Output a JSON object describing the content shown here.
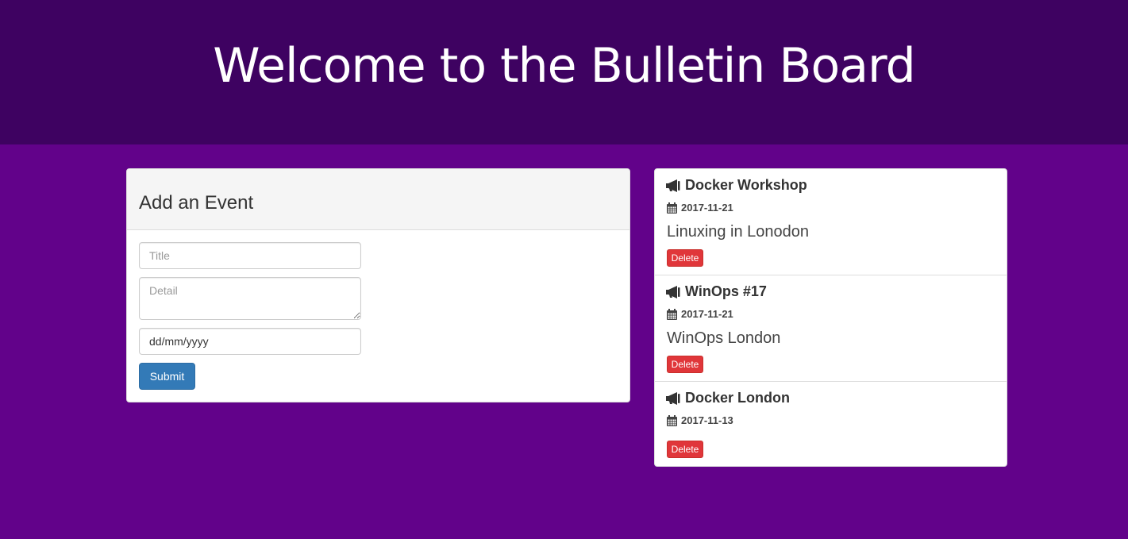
{
  "header": {
    "title": "Welcome to the Bulletin Board"
  },
  "add_event": {
    "heading": "Add an Event",
    "title_placeholder": "Title",
    "detail_placeholder": "Detail",
    "date_value": "dd/mm/yyyy",
    "submit_label": "Submit"
  },
  "events": [
    {
      "title": "Docker Workshop",
      "date": "2017-11-21",
      "detail": "Linuxing in Lonodon",
      "delete_label": "Delete"
    },
    {
      "title": "WinOps #17",
      "date": "2017-11-21",
      "detail": "WinOps London",
      "delete_label": "Delete"
    },
    {
      "title": "Docker London",
      "date": "2017-11-13",
      "detail": "",
      "delete_label": "Delete"
    }
  ],
  "icons": {
    "event_icon": "bullhorn-icon",
    "date_icon": "calendar-icon"
  },
  "colors": {
    "header_bg": "#3e0261",
    "page_bg": "#62028a",
    "submit_bg": "#337ab7",
    "delete_bg": "#e0363a"
  }
}
